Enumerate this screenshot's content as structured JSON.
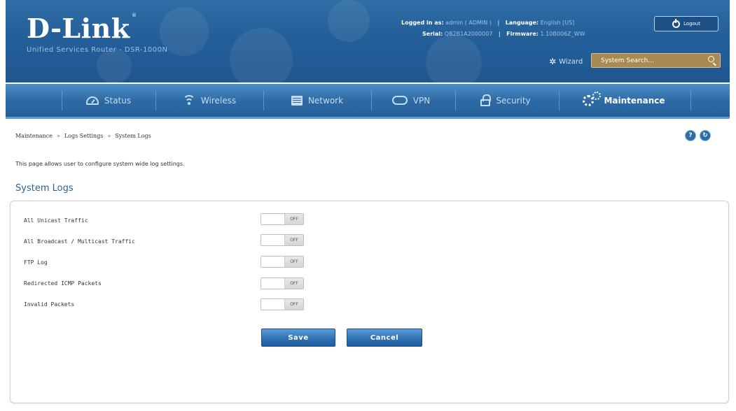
{
  "header": {
    "logo": "D-Link",
    "tagline": "Unified Services Router - DSR-1000N",
    "logged_in_label": "Logged in as:",
    "logged_in_value": "admin ( ADMIN )",
    "language_label": "Language:",
    "language_value": "English [US]",
    "serial_label": "Serial:",
    "serial_value": "QB2B1A2000007",
    "firmware_label": "Firmware:",
    "firmware_value": "1.10B006Z_WW",
    "logout_label": "Logout",
    "wizard_label": "Wizard",
    "search_placeholder": "System Search..."
  },
  "nav": {
    "items": [
      {
        "label": "Status",
        "icon": "gauge-icon"
      },
      {
        "label": "Wireless",
        "icon": "wifi-icon"
      },
      {
        "label": "Network",
        "icon": "network-icon"
      },
      {
        "label": "VPN",
        "icon": "cloud-icon"
      },
      {
        "label": "Security",
        "icon": "lock-icon"
      },
      {
        "label": "Maintenance",
        "icon": "gear-icon"
      }
    ],
    "active": "Maintenance"
  },
  "breadcrumb": [
    "Maintenance",
    "Logs Settings",
    "System Logs"
  ],
  "description": "This page allows user to configure system wide log settings.",
  "section_title": "System Logs",
  "settings": [
    {
      "label": "All Unicast Traffic",
      "state": "OFF"
    },
    {
      "label": "All Broadcast / Multicast Traffic",
      "state": "OFF"
    },
    {
      "label": "FTP Log",
      "state": "OFF"
    },
    {
      "label": "Redirected ICMP Packets",
      "state": "OFF"
    },
    {
      "label": "Invalid Packets",
      "state": "OFF"
    }
  ],
  "buttons": {
    "save": "Save",
    "cancel": "Cancel"
  },
  "colors": {
    "brand_blue": "#2f6ea6",
    "accent_blue": "#2b5f94",
    "search_gold": "#a88a52"
  }
}
